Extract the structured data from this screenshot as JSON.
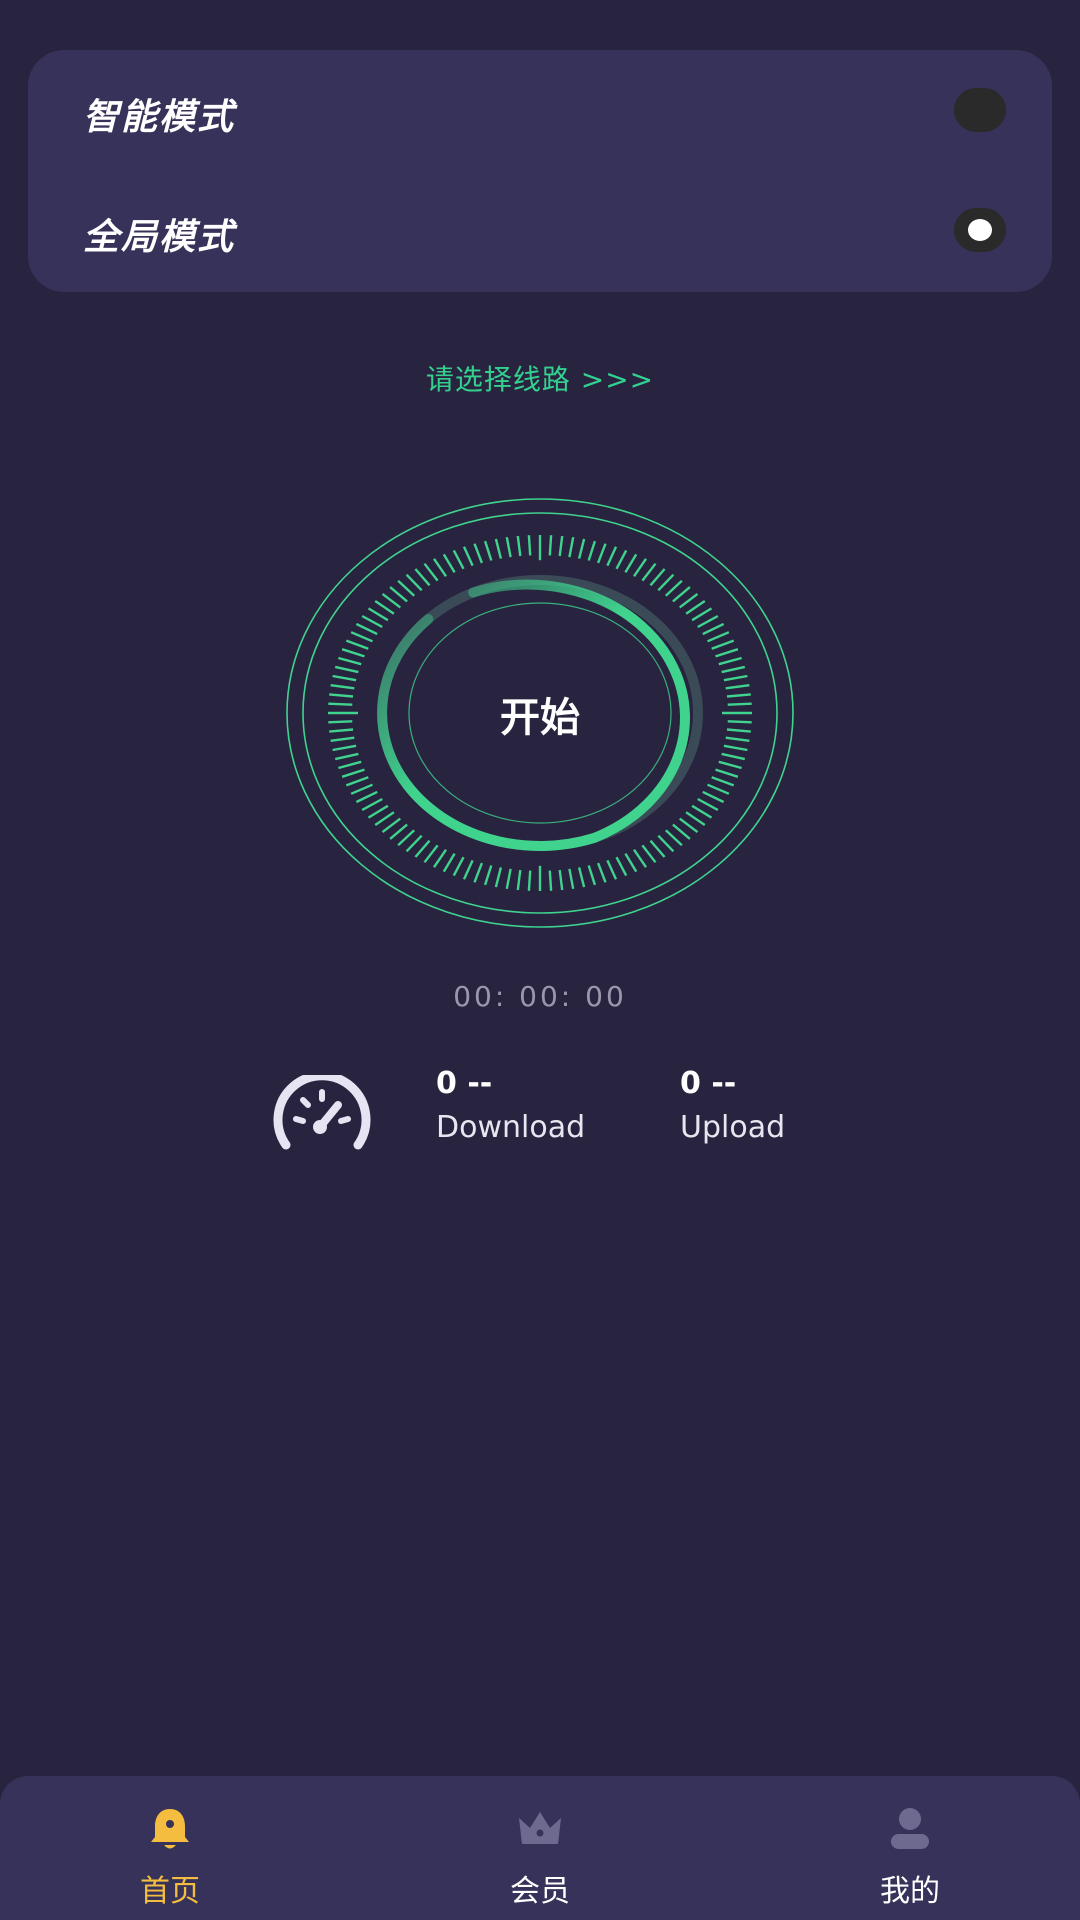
{
  "modes": {
    "smart": {
      "label": "智能模式",
      "selected": false
    },
    "global": {
      "label": "全局模式",
      "selected": true
    }
  },
  "route": {
    "label": "请选择线路 >>>"
  },
  "connect": {
    "label": "开始"
  },
  "timer": {
    "value": "00:  00:  00"
  },
  "stats": {
    "download": {
      "value": "0 --",
      "label": "Download"
    },
    "upload": {
      "value": "0 --",
      "label": "Upload"
    }
  },
  "tabs": [
    {
      "label": "首页",
      "icon": "bell-icon",
      "active": true
    },
    {
      "label": "会员",
      "icon": "crown-icon",
      "active": false
    },
    {
      "label": "我的",
      "icon": "user-icon",
      "active": false
    }
  ],
  "colors": {
    "background": "#28233f",
    "card": "#37325a",
    "accent_green": "#3fd38e",
    "tab_active": "#f5bd3f",
    "tab_inactive_icon": "#6e6a8f"
  }
}
